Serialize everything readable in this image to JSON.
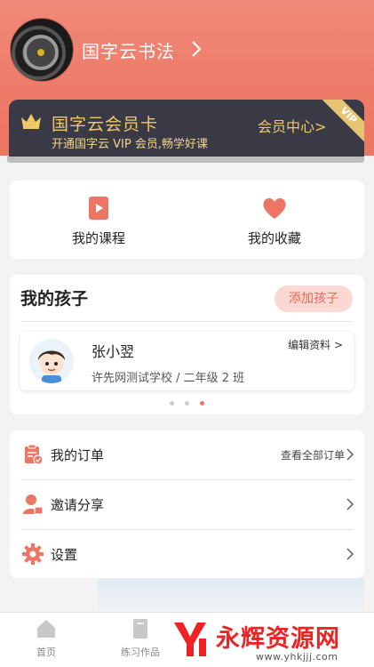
{
  "profile": {
    "name": "国字云书法",
    "avatar_icon": "car-wheel-avatar",
    "arrow_icon": "chevron-right-icon"
  },
  "vip": {
    "title": "国字云会员卡",
    "subtitle": "开通国字云 VIP 会员,畅学好课",
    "center_label": "会员中心>",
    "ribbon": "VIP",
    "crown_icon": "crown-icon",
    "bg_color": "#3a3a46",
    "accent_color": "#f0c86a"
  },
  "quick_links": [
    {
      "label": "我的课程",
      "icon": "play-book-icon"
    },
    {
      "label": "我的收藏",
      "icon": "heart-icon"
    }
  ],
  "kids": {
    "title": "我的孩子",
    "add_button": "添加孩子",
    "child": {
      "name": "张小翌",
      "edit_label": "编辑资料 >",
      "school": "许先网测试学校 / 二年级 2 班"
    },
    "pager": {
      "count": 3,
      "active": 3
    }
  },
  "menu": [
    {
      "label": "我的订单",
      "icon": "clipboard-icon",
      "right_text": "查看全部订单"
    },
    {
      "label": "邀请分享",
      "icon": "user-share-icon",
      "right_text": ""
    },
    {
      "label": "设置",
      "icon": "gear-icon",
      "right_text": ""
    }
  ],
  "tabs": [
    {
      "label": "首页",
      "icon": "home-icon"
    },
    {
      "label": "练习作品",
      "icon": "notebook-icon"
    }
  ],
  "watermark": {
    "title": "永辉资源网",
    "url": "www.yhkjjj.com"
  },
  "theme": {
    "primary": "#ec7563",
    "header": "#ee7a68"
  }
}
